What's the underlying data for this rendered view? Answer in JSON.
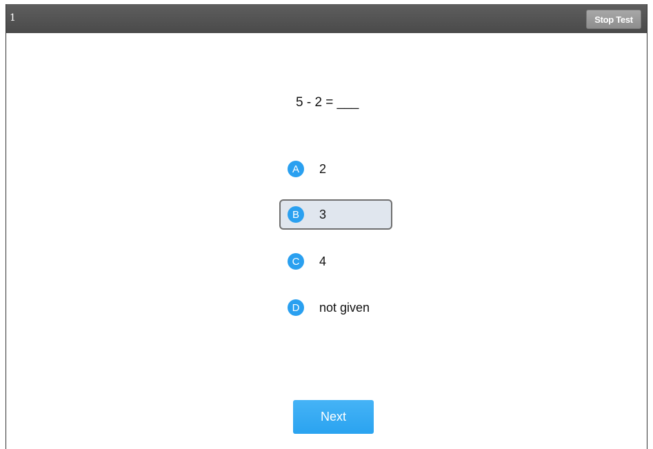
{
  "header": {
    "question_number": "1",
    "stop_label": "Stop Test"
  },
  "question": {
    "text": "5 - 2 = ___"
  },
  "options": [
    {
      "letter": "A",
      "text": "2",
      "selected": false
    },
    {
      "letter": "B",
      "text": "3",
      "selected": true
    },
    {
      "letter": "C",
      "text": "4",
      "selected": false
    },
    {
      "letter": "D",
      "text": "not given",
      "selected": false
    }
  ],
  "footer": {
    "next_label": "Next"
  },
  "colors": {
    "accent": "#2aa0f0",
    "topbar": "#555555",
    "selected_bg": "#e0e6ee"
  }
}
